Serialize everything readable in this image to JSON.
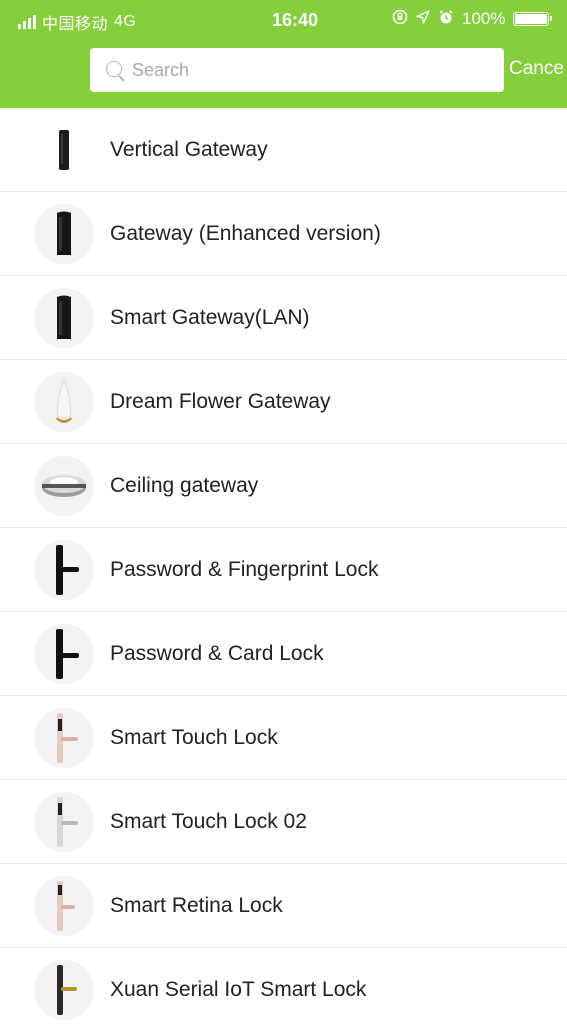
{
  "status_bar": {
    "carrier": "中国移动",
    "network": "4G",
    "time": "16:40",
    "battery": "100%",
    "icons": [
      "signal-icon",
      "lock-rotation-icon",
      "location-icon",
      "alarm-icon",
      "battery-icon"
    ]
  },
  "search": {
    "placeholder": "Search",
    "cancel_label": "Cance"
  },
  "colors": {
    "header_bg": "#86cf3c",
    "divider": "#e6e6e6"
  },
  "devices": [
    {
      "label": "Vertical Gateway",
      "icon": "vertical-gateway-icon"
    },
    {
      "label": "Gateway (Enhanced version)",
      "icon": "gateway-enhanced-icon"
    },
    {
      "label": "Smart Gateway(LAN)",
      "icon": "smart-gateway-lan-icon"
    },
    {
      "label": "Dream Flower Gateway",
      "icon": "dream-flower-gateway-icon"
    },
    {
      "label": "Ceiling gateway",
      "icon": "ceiling-gateway-icon"
    },
    {
      "label": "Password & Fingerprint Lock",
      "icon": "fingerprint-lock-icon"
    },
    {
      "label": "Password & Card Lock",
      "icon": "card-lock-icon"
    },
    {
      "label": "Smart Touch Lock",
      "icon": "touch-lock-icon"
    },
    {
      "label": "Smart Touch Lock 02",
      "icon": "touch-lock-02-icon"
    },
    {
      "label": "Smart Retina Lock",
      "icon": "retina-lock-icon"
    },
    {
      "label": "Xuan Serial IoT Smart Lock",
      "icon": "xuan-lock-icon"
    }
  ]
}
